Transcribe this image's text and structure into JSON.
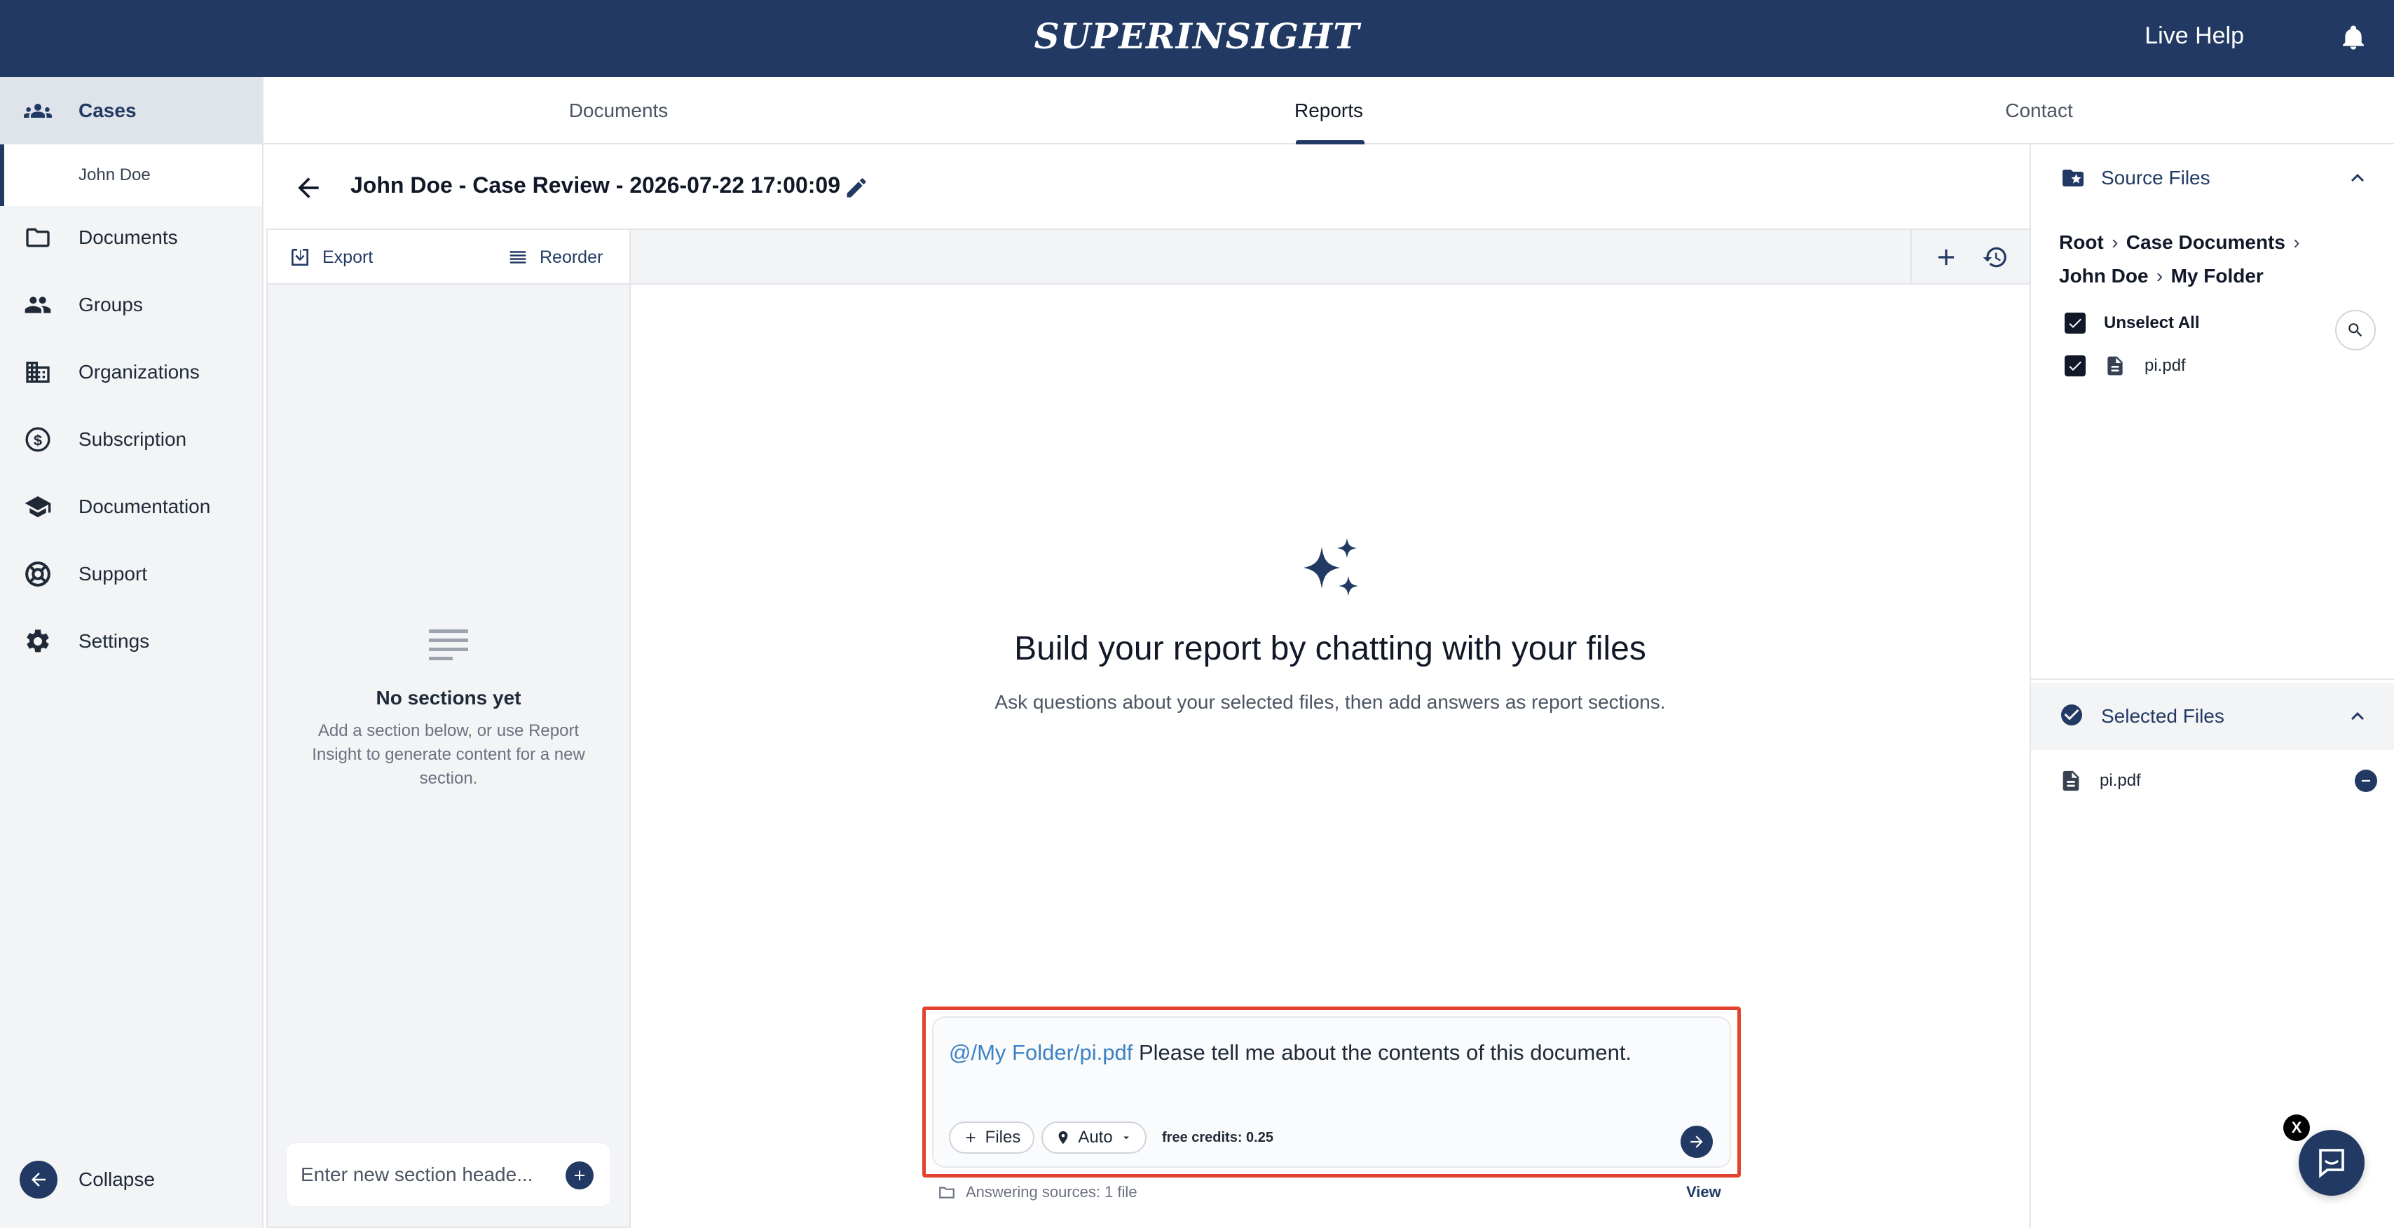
{
  "header": {
    "logo": "SUPERINSIGHT",
    "live_help": "Live Help"
  },
  "sidebar": {
    "items": [
      {
        "label": "Cases",
        "icon": "groups-icon"
      },
      {
        "label": "Documents",
        "icon": "folder-icon"
      },
      {
        "label": "Groups",
        "icon": "people-icon"
      },
      {
        "label": "Organizations",
        "icon": "building-icon"
      },
      {
        "label": "Subscription",
        "icon": "dollar-circle-icon"
      },
      {
        "label": "Documentation",
        "icon": "school-icon"
      },
      {
        "label": "Support",
        "icon": "lifebuoy-icon"
      },
      {
        "label": "Settings",
        "icon": "gear-icon"
      }
    ],
    "sub_item": "John Doe",
    "collapse_label": "Collapse"
  },
  "tabs": [
    {
      "label": "Documents"
    },
    {
      "label": "Reports",
      "active": true
    },
    {
      "label": "Contact"
    }
  ],
  "report": {
    "title": "John Doe - Case Review - 2026-07-22 17:00:09"
  },
  "outline": {
    "export_label": "Export",
    "reorder_label": "Reorder",
    "empty_title": "No sections yet",
    "empty_desc": "Add a section below, or use Report Insight to generate content for a new section.",
    "section_input_placeholder": "Enter new section heade..."
  },
  "main": {
    "hero_title": "Build your report by chatting with your files",
    "hero_sub": "Ask questions about your selected files, then add answers as report sections."
  },
  "chat": {
    "mention": "@/My Folder/pi.pdf",
    "text": " Please tell me about the contents of this document.",
    "files_chip": "Files",
    "model_chip": "Auto",
    "credits": "free credits: 0.25",
    "answering": "Answering sources: 1 file",
    "view_link": "View"
  },
  "source_files": {
    "title": "Source Files",
    "breadcrumb": [
      "Root",
      "Case Documents",
      "John Doe",
      "My Folder"
    ],
    "unselect_all": "Unselect All",
    "files": [
      "pi.pdf"
    ]
  },
  "selected_files": {
    "title": "Selected Files",
    "files": [
      "pi.pdf"
    ]
  },
  "intercom": {
    "close_label": "X"
  },
  "colors": {
    "brand": "#223a63",
    "highlight": "#e2432e",
    "link": "#3b82c4"
  }
}
